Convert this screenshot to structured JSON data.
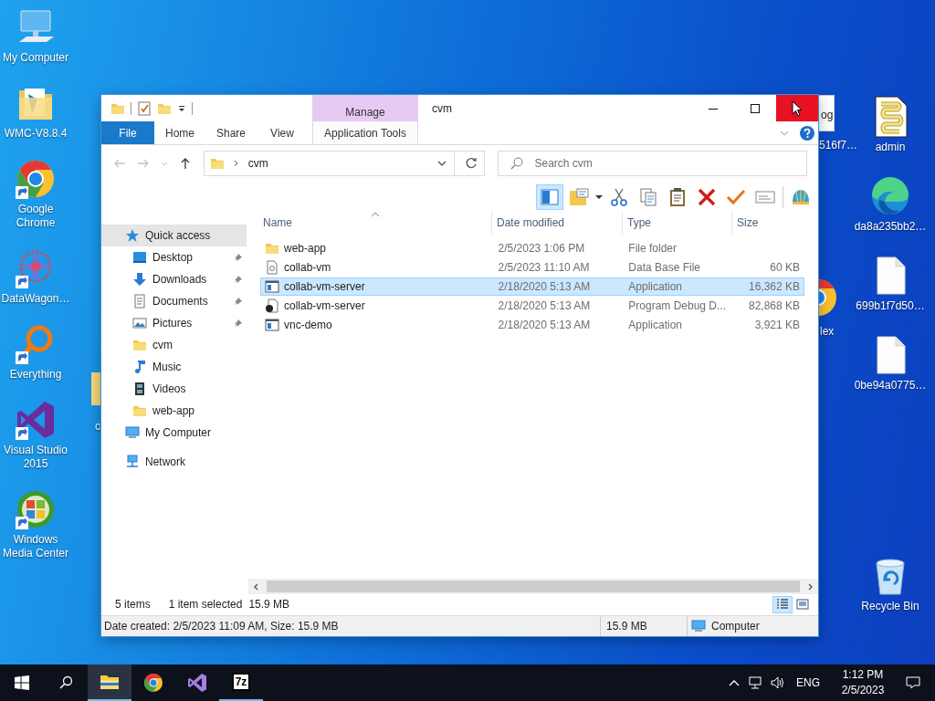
{
  "desktop": {
    "left_icons": [
      {
        "label": "My Computer",
        "kind": "computer",
        "shortcut": false
      },
      {
        "label": "WMC-V8.8.4",
        "kind": "folder",
        "shortcut": false
      },
      {
        "label": "Google Chrome",
        "kind": "chrome",
        "shortcut": true
      },
      {
        "label": "DataWagon…",
        "kind": "datawagon",
        "shortcut": true
      },
      {
        "label": "Everything",
        "kind": "everything",
        "shortcut": true
      },
      {
        "label": "Visual Studio 2015",
        "kind": "vs",
        "shortcut": true
      },
      {
        "label": "Windows Media Center",
        "kind": "wmc",
        "shortcut": true
      }
    ],
    "right_icons": [
      {
        "label": "admin",
        "kind": "script",
        "shortcut": false
      },
      {
        "label": "da8a235bb2…",
        "kind": "edge",
        "shortcut": false
      },
      {
        "label": "699b1f7d50…",
        "kind": "file",
        "shortcut": false
      },
      {
        "label": "0be94a0775…",
        "kind": "file",
        "shortcut": false
      },
      {
        "label": "Recycle Bin",
        "kind": "recycle",
        "shortcut": false
      }
    ],
    "partly_hidden_icons": [
      {
        "label": "516f7…",
        "kind": "textfile",
        "icon_text": "og"
      },
      {
        "label": "lex",
        "kind": "chrome"
      },
      {
        "label": "c",
        "kind": "folder"
      }
    ]
  },
  "window": {
    "title": "cvm",
    "context_group": "Manage",
    "tabs": [
      {
        "label": "File",
        "kind": "file",
        "selected": false
      },
      {
        "label": "Home",
        "kind": "normal",
        "selected": false
      },
      {
        "label": "Share",
        "kind": "normal",
        "selected": false
      },
      {
        "label": "View",
        "kind": "normal",
        "selected": false
      },
      {
        "label": "Application Tools",
        "kind": "contextual",
        "selected": false
      }
    ],
    "address": {
      "path": "cvm"
    },
    "search": {
      "placeholder": "Search cvm"
    },
    "toolbar": [
      {
        "kind": "preview",
        "pressed": true
      },
      {
        "kind": "properties",
        "pressed": false
      },
      {
        "kind": "cut",
        "pressed": false
      },
      {
        "kind": "copy",
        "pressed": false
      },
      {
        "kind": "paste",
        "pressed": false
      },
      {
        "kind": "delete",
        "pressed": false
      },
      {
        "kind": "check",
        "pressed": false
      },
      {
        "kind": "rename",
        "pressed": false
      },
      {
        "kind": "shell",
        "pressed": false
      }
    ],
    "nav_pane": [
      {
        "label": "Quick access",
        "kind": "star",
        "selected": true,
        "children": [
          {
            "label": "Desktop",
            "kind": "desktop",
            "pinned": true,
            "selected": false
          },
          {
            "label": "Downloads",
            "kind": "downloads",
            "pinned": true,
            "selected": false
          },
          {
            "label": "Documents",
            "kind": "documents",
            "pinned": true,
            "selected": false
          },
          {
            "label": "Pictures",
            "kind": "pictures",
            "pinned": true,
            "selected": false
          },
          {
            "label": "cvm",
            "kind": "folder",
            "pinned": false,
            "selected": false
          },
          {
            "label": "Music",
            "kind": "music",
            "pinned": false,
            "selected": false
          },
          {
            "label": "Videos",
            "kind": "videos",
            "pinned": false,
            "selected": false
          },
          {
            "label": "web-app",
            "kind": "folder",
            "pinned": false,
            "selected": false
          }
        ]
      },
      {
        "label": "My Computer",
        "kind": "computer",
        "selected": false
      },
      {
        "label": "Network",
        "kind": "network",
        "selected": false
      }
    ],
    "file_list": {
      "columns": [
        {
          "label": "Name",
          "sorted": true
        },
        {
          "label": "Date modified",
          "sorted": false
        },
        {
          "label": "Type",
          "sorted": false
        },
        {
          "label": "Size",
          "sorted": false
        }
      ],
      "rows": [
        {
          "name": "web-app",
          "kind": "folder",
          "date": "2/5/2023 1:06 PM",
          "type": "File folder",
          "selected": false
        },
        {
          "name": "collab-vm",
          "kind": "database",
          "date": "2/5/2023 11:10 AM",
          "type": "Data Base File",
          "size": "60 KB",
          "selected": false
        },
        {
          "name": "collab-vm-server",
          "kind": "application",
          "date": "2/18/2020 5:13 AM",
          "type": "Application",
          "size": "16,362 KB",
          "selected": true
        },
        {
          "name": "collab-vm-server",
          "kind": "debug",
          "date": "2/18/2020 5:13 AM",
          "type": "Program Debug D...",
          "size": "82,868 KB",
          "selected": false
        },
        {
          "name": "vnc-demo",
          "kind": "application",
          "date": "2/18/2020 5:13 AM",
          "type": "Application",
          "size": "3,921 KB",
          "selected": false
        }
      ]
    },
    "status": {
      "item_count": "5 items",
      "selection": "1 item selected",
      "selection_size": "15.9 MB"
    },
    "view_buttons": [
      {
        "kind": "details",
        "selected": true
      },
      {
        "kind": "large",
        "selected": false
      }
    ],
    "details_bar": {
      "info": "Date created: 2/5/2023 11:09 AM, Size: 15.9 MB",
      "size": "15.9 MB",
      "location": "Computer"
    }
  },
  "taskbar": {
    "apps": [
      {
        "kind": "explorer",
        "active": true,
        "running": true
      },
      {
        "kind": "chrome",
        "active": false,
        "running": false
      },
      {
        "kind": "vs",
        "active": false,
        "running": false
      },
      {
        "kind": "archiver",
        "label": "7z",
        "active": false,
        "running": true
      }
    ],
    "language": "ENG",
    "time": "1:12 PM",
    "date": "2/5/2023"
  }
}
